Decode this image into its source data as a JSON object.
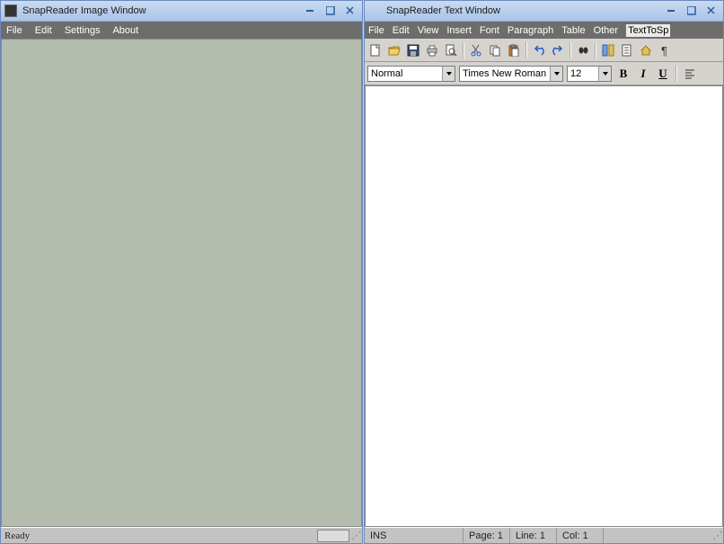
{
  "left": {
    "title": "SnapReader Image Window",
    "menu": [
      "File",
      "Edit",
      "Settings",
      "About"
    ],
    "status": "Ready"
  },
  "right": {
    "title": "SnapReader Text Window",
    "menu": [
      "File",
      "Edit",
      "View",
      "Insert",
      "Font",
      "Paragraph",
      "Table",
      "Other",
      "TextToSp"
    ],
    "style": "Normal",
    "font": "Times New Roman",
    "size": "12",
    "bold": "B",
    "italic": "I",
    "underline": "U",
    "status": {
      "ins": "INS",
      "page": "Page: 1",
      "line": "Line: 1",
      "col": "Col: 1"
    }
  }
}
